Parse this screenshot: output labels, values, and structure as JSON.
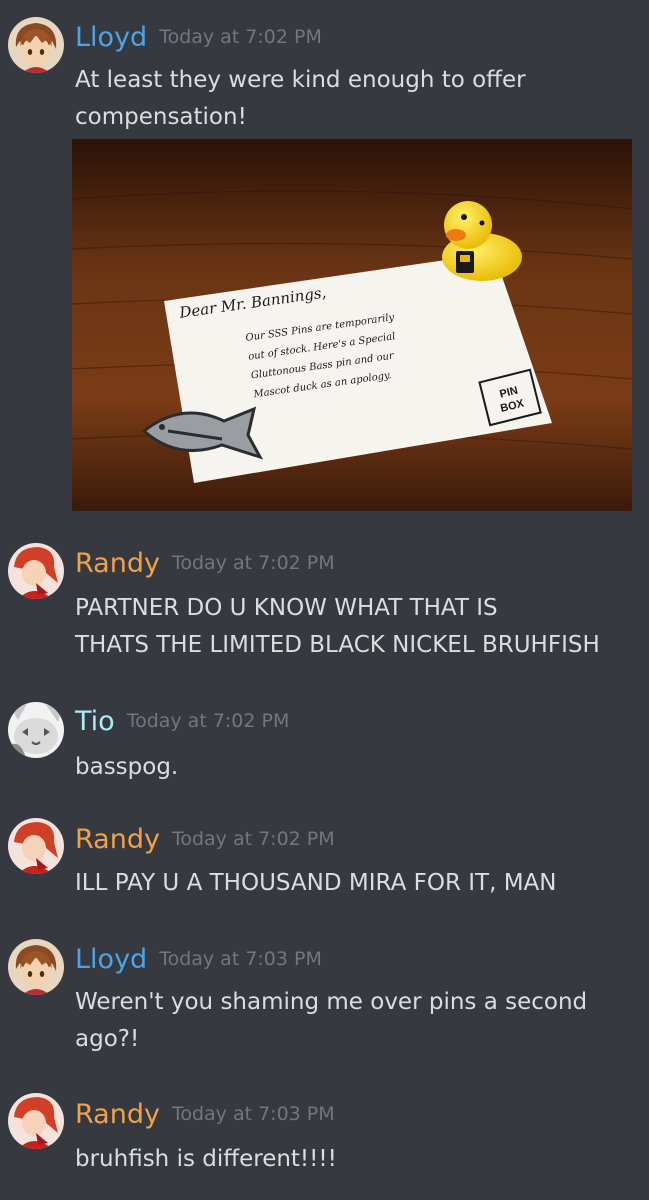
{
  "colors": {
    "background": "#36393f",
    "timestamp": "#72767d",
    "message_text": "#dcddde",
    "lloyd": "#4ba4e8",
    "randy": "#f0a24a",
    "tio": "#a8ecf4"
  },
  "messages": [
    {
      "author": "Lloyd",
      "timestamp": "Today at 7:02 PM",
      "lines": [
        "At least they were kind enough to offer",
        "compensation!"
      ],
      "attachment": {
        "card": {
          "greeting": "Dear Mr. Bannings,",
          "body": [
            "Our SSS Pins are temporarily",
            "out of stock. Here's a Special",
            "Gluttonous Bass pin and our",
            "Mascot duck as an apology."
          ],
          "stamp": [
            "PIN",
            "BOX"
          ]
        }
      }
    },
    {
      "author": "Randy",
      "timestamp": "Today at 7:02 PM",
      "lines": [
        "PARTNER DO U KNOW WHAT THAT IS",
        "THATS THE LIMITED BLACK NICKEL BRUHFISH"
      ]
    },
    {
      "author": "Tio",
      "timestamp": "Today at 7:02 PM",
      "lines": [
        "basspog."
      ]
    },
    {
      "author": "Randy",
      "timestamp": "Today at 7:02 PM",
      "lines": [
        "ILL PAY U A THOUSAND MIRA FOR IT, MAN"
      ]
    },
    {
      "author": "Lloyd",
      "timestamp": "Today at 7:03 PM",
      "lines": [
        "Weren't you shaming me over pins a second",
        "ago?!"
      ]
    },
    {
      "author": "Randy",
      "timestamp": "Today at 7:03 PM",
      "lines": [
        "bruhfish is different!!!!"
      ]
    }
  ]
}
